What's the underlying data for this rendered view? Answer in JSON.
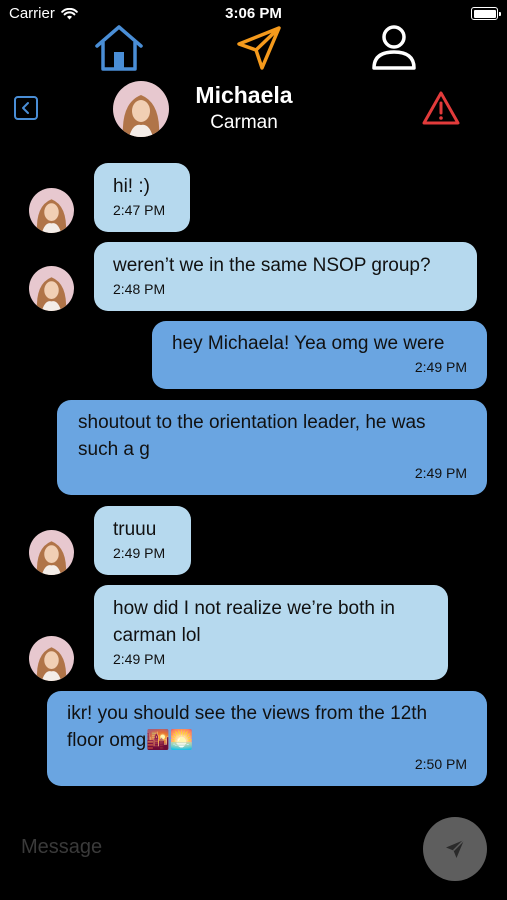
{
  "status_bar": {
    "carrier": "Carrier",
    "time": "3:06 PM"
  },
  "nav": {
    "icons": [
      "home-icon",
      "send-icon",
      "profile-icon"
    ],
    "active": "send-icon",
    "accent": "#f59a1c",
    "home_color": "#4a8ed6"
  },
  "header": {
    "first_name": "Michaela",
    "last_name": "Carman",
    "back_icon": "back-icon",
    "report_icon": "warning-icon",
    "warning_color": "#e23b3b"
  },
  "messages": [
    {
      "from": "them",
      "text": "hi! :)",
      "time": "2:47 PM"
    },
    {
      "from": "them",
      "text": "weren’t we in the same NSOP group?",
      "time": "2:48 PM"
    },
    {
      "from": "me",
      "text": "hey Michaela! Yea omg we were",
      "time": "2:49 PM"
    },
    {
      "from": "me",
      "text": "shoutout to the orientation leader, he was such a g",
      "time": "2:49 PM"
    },
    {
      "from": "them",
      "text": "truuu",
      "time": "2:49 PM"
    },
    {
      "from": "them",
      "text": "how did I not realize we’re both in carman lol",
      "time": "2:49 PM"
    },
    {
      "from": "me",
      "text": "ikr! you should see the views from the 12th floor omg🌇🌅",
      "time": "2:50 PM"
    }
  ],
  "composer": {
    "placeholder": "Message",
    "send_icon": "send-icon"
  },
  "colors": {
    "incoming_bubble": "#b6d9ee",
    "outgoing_bubble": "#6aa5e1",
    "background": "#000000"
  }
}
